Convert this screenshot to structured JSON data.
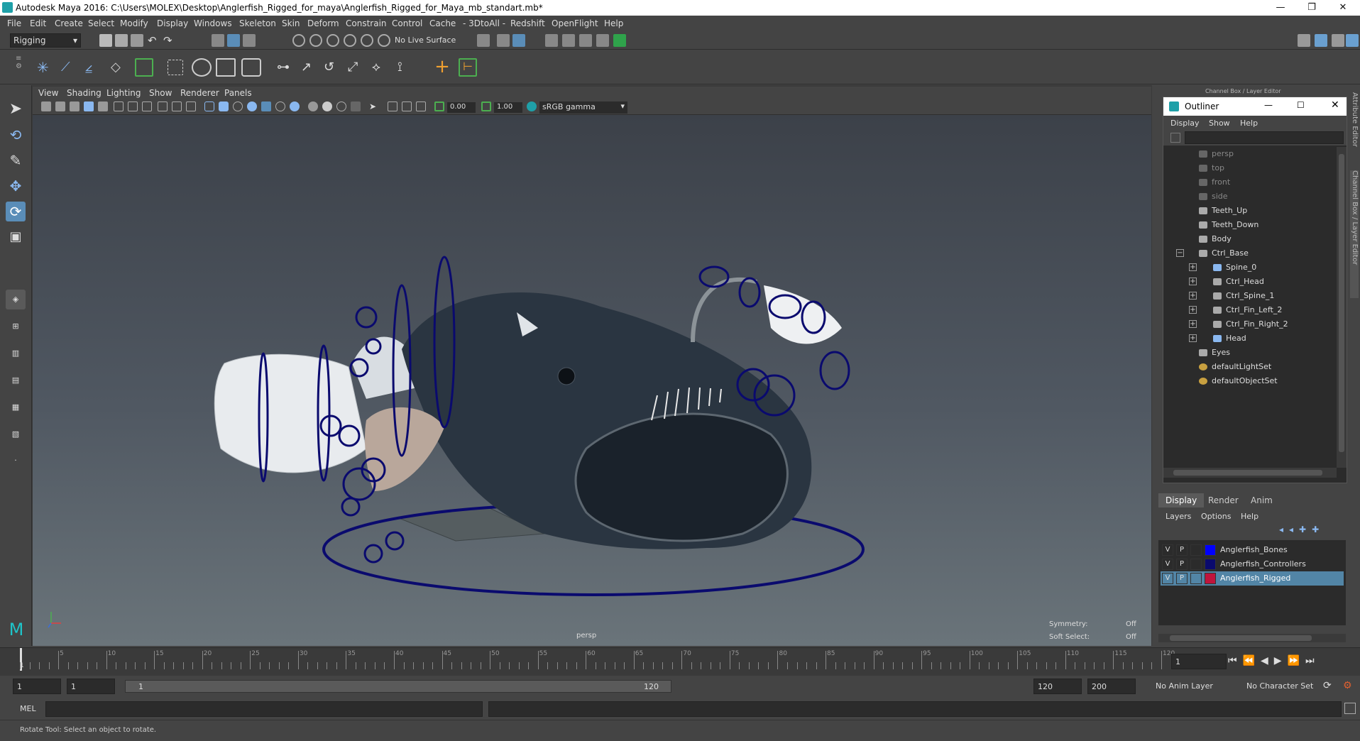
{
  "window": {
    "title": "Autodesk Maya 2016: C:\\Users\\MOLEX\\Desktop\\Anglerfish_Rigged_for_maya\\Anglerfish_Rigged_for_Maya_mb_standart.mb*",
    "minimize": "—",
    "restore": "❐",
    "close": "✕"
  },
  "menus": [
    "File",
    "Edit",
    "Create",
    "Select",
    "Modify",
    "Display",
    "Windows",
    "Skeleton",
    "Skin",
    "Deform",
    "Constrain",
    "Control",
    "Cache",
    "- 3DtoAll -",
    "Redshift",
    "OpenFlight",
    "Help"
  ],
  "toolbar": {
    "mode": "Rigging",
    "live_surface": "No Live Surface"
  },
  "viewport": {
    "menus": [
      "View",
      "Shading",
      "Lighting",
      "Show",
      "Renderer",
      "Panels"
    ],
    "near_value": "0.00",
    "far_value": "1.00",
    "color_space": "sRGB gamma",
    "camera_label": "persp",
    "symmetry_label": "Symmetry:",
    "symmetry_value": "Off",
    "soft_select_label": "Soft Select:",
    "soft_select_value": "Off"
  },
  "right_panel": {
    "header": "Channel Box / Layer Editor",
    "side_tab_attr": "Attribute Editor",
    "side_tab_channel": "Channel Box / Layer Editor"
  },
  "outliner": {
    "title": "Outliner",
    "menus": [
      "Display",
      "Show",
      "Help"
    ],
    "items": [
      {
        "label": "persp",
        "depth": 0,
        "dim": true,
        "kind": "camera",
        "expander": ""
      },
      {
        "label": "top",
        "depth": 0,
        "dim": true,
        "kind": "camera",
        "expander": ""
      },
      {
        "label": "front",
        "depth": 0,
        "dim": true,
        "kind": "camera",
        "expander": ""
      },
      {
        "label": "side",
        "depth": 0,
        "dim": true,
        "kind": "camera",
        "expander": ""
      },
      {
        "label": "Teeth_Up",
        "depth": 0,
        "dim": false,
        "kind": "mesh",
        "expander": ""
      },
      {
        "label": "Teeth_Down",
        "depth": 0,
        "dim": false,
        "kind": "mesh",
        "expander": ""
      },
      {
        "label": "Body",
        "depth": 0,
        "dim": false,
        "kind": "mesh",
        "expander": ""
      },
      {
        "label": "Ctrl_Base",
        "depth": 0,
        "dim": false,
        "kind": "mesh",
        "expander": "−"
      },
      {
        "label": "Spine_0",
        "depth": 1,
        "dim": false,
        "kind": "joint",
        "expander": "+"
      },
      {
        "label": "Ctrl_Head",
        "depth": 1,
        "dim": false,
        "kind": "mesh",
        "expander": "+"
      },
      {
        "label": "Ctrl_Spine_1",
        "depth": 1,
        "dim": false,
        "kind": "mesh",
        "expander": "+"
      },
      {
        "label": "Ctrl_Fin_Left_2",
        "depth": 1,
        "dim": false,
        "kind": "mesh",
        "expander": "+"
      },
      {
        "label": "Ctrl_Fin_Right_2",
        "depth": 1,
        "dim": false,
        "kind": "mesh",
        "expander": "+"
      },
      {
        "label": "Head",
        "depth": 1,
        "dim": false,
        "kind": "joint",
        "expander": "+"
      },
      {
        "label": "Eyes",
        "depth": 0,
        "dim": false,
        "kind": "mesh",
        "expander": ""
      },
      {
        "label": "defaultLightSet",
        "depth": 0,
        "dim": false,
        "kind": "set",
        "expander": ""
      },
      {
        "label": "defaultObjectSet",
        "depth": 0,
        "dim": false,
        "kind": "set",
        "expander": ""
      }
    ]
  },
  "layer_editor": {
    "tabs": [
      "Display",
      "Render",
      "Anim"
    ],
    "menus": [
      "Layers",
      "Options",
      "Help"
    ],
    "layers": [
      {
        "v": "V",
        "p": "P",
        "color": "#0000ff",
        "name": "Anglerfish_Bones",
        "selected": false
      },
      {
        "v": "V",
        "p": "P",
        "color": "#0a0a6e",
        "name": "Anglerfish_Controllers",
        "selected": false
      },
      {
        "v": "V",
        "p": "P",
        "color": "#c0143c",
        "name": "Anglerfish_Rigged",
        "selected": true
      }
    ]
  },
  "timeline": {
    "ticks": [
      "5",
      "10",
      "15",
      "20",
      "25",
      "30",
      "35",
      "40",
      "45",
      "50",
      "55",
      "60",
      "65",
      "70",
      "75",
      "80",
      "85",
      "90",
      "95",
      "100",
      "105",
      "110",
      "115",
      "120"
    ],
    "first_tick": "1",
    "current_frame": "1"
  },
  "range": {
    "start": "1",
    "playback_start": "1",
    "slider_start": "1",
    "slider_end": "120",
    "playback_end": "120",
    "end": "200",
    "anim_layer": "No Anim Layer",
    "character_set": "No Character Set"
  },
  "mel": {
    "label": "MEL"
  },
  "help_line": "Rotate Tool: Select an object to rotate."
}
